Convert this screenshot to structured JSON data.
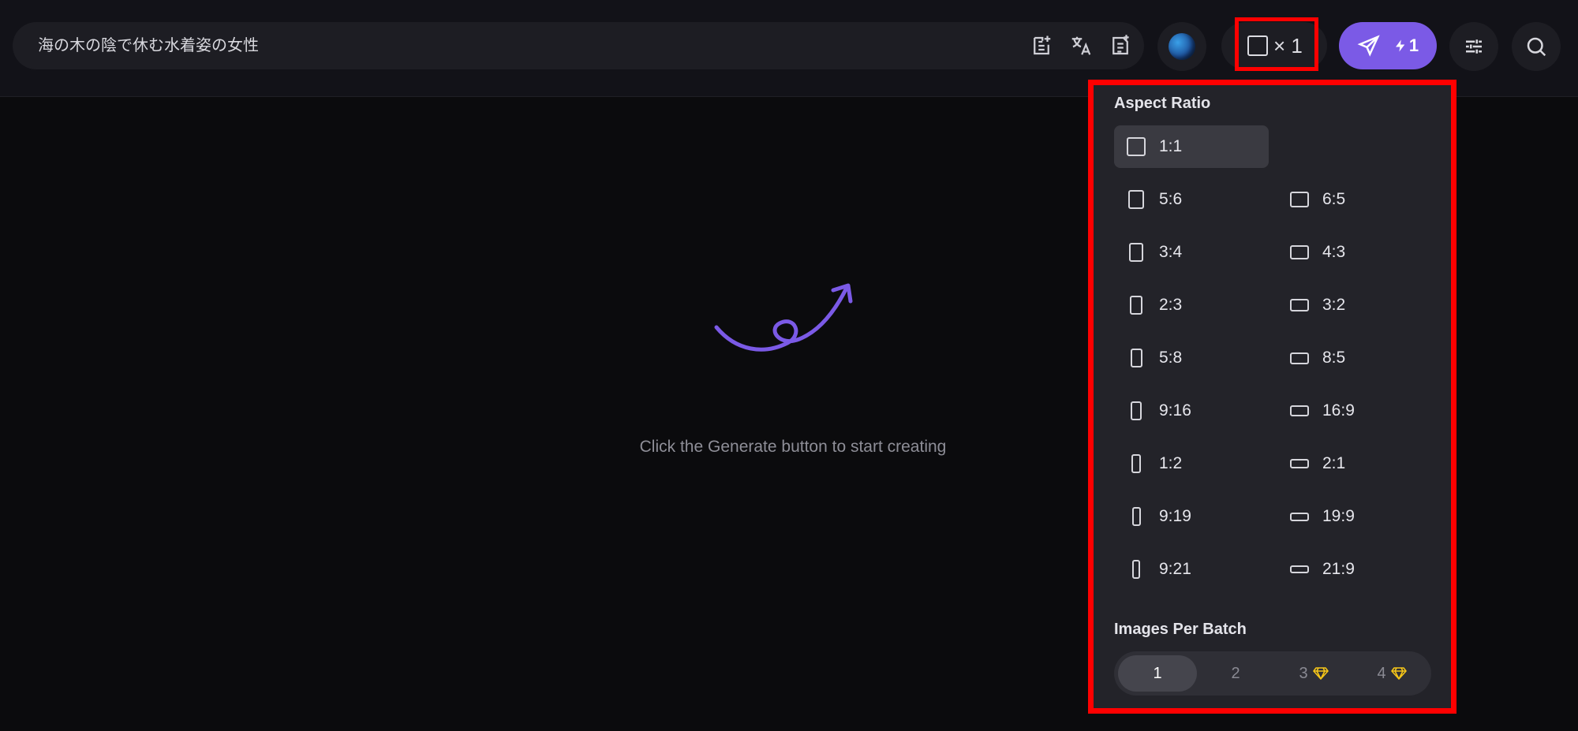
{
  "prompt": {
    "text": "海の木の陰で休む水着姿の女性"
  },
  "toolbar": {
    "ratio_count": "× 1",
    "generate_cost": "1"
  },
  "canvas": {
    "hint": "Click the Generate button to start creating"
  },
  "panel": {
    "aspect_title": "Aspect Ratio",
    "ratios": [
      {
        "label": "1:1",
        "selected": true
      },
      {
        "label": "5:6"
      },
      {
        "label": "6:5"
      },
      {
        "label": "3:4"
      },
      {
        "label": "4:3"
      },
      {
        "label": "2:3"
      },
      {
        "label": "3:2"
      },
      {
        "label": "5:8"
      },
      {
        "label": "8:5"
      },
      {
        "label": "9:16"
      },
      {
        "label": "16:9"
      },
      {
        "label": "1:2"
      },
      {
        "label": "2:1"
      },
      {
        "label": "9:19"
      },
      {
        "label": "19:9"
      },
      {
        "label": "9:21"
      },
      {
        "label": "21:9"
      }
    ],
    "batch_title": "Images Per Batch",
    "batch_options": [
      {
        "label": "1",
        "selected": true
      },
      {
        "label": "2"
      },
      {
        "label": "3",
        "premium": true
      },
      {
        "label": "4",
        "premium": true
      }
    ]
  },
  "colors": {
    "accent": "#7b5ae6",
    "highlight": "#ff0000",
    "premium": "#f5c518"
  }
}
